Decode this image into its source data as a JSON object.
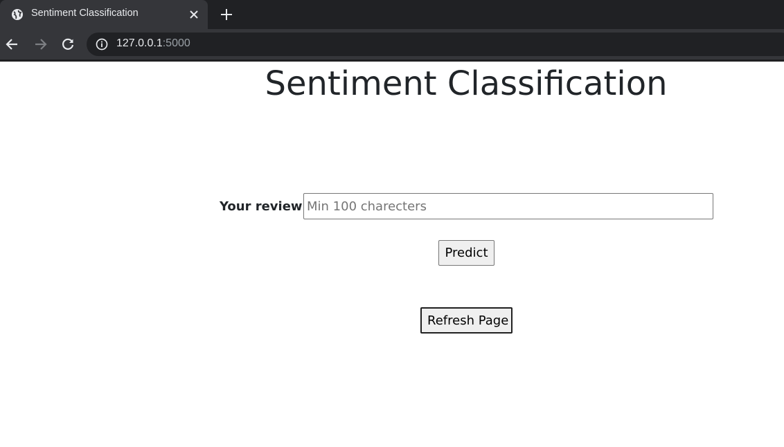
{
  "browser": {
    "tab_title": "Sentiment Classification",
    "url_host": "127.0.0.1",
    "url_port": ":5000"
  },
  "page": {
    "title": "Sentiment Classification",
    "review_label": "Your review:",
    "review_placeholder": "Min 100 charecters",
    "review_value": "",
    "predict_label": "Predict",
    "refresh_label": "Refresh Page"
  },
  "colors": {
    "chrome_dark": "#202124",
    "chrome_tab": "#35363a",
    "text": "#212529",
    "button_bg": "#efefef"
  },
  "icons": [
    "globe-icon",
    "close-icon",
    "plus-icon",
    "back-arrow-icon",
    "forward-arrow-icon",
    "reload-icon",
    "info-icon"
  ]
}
